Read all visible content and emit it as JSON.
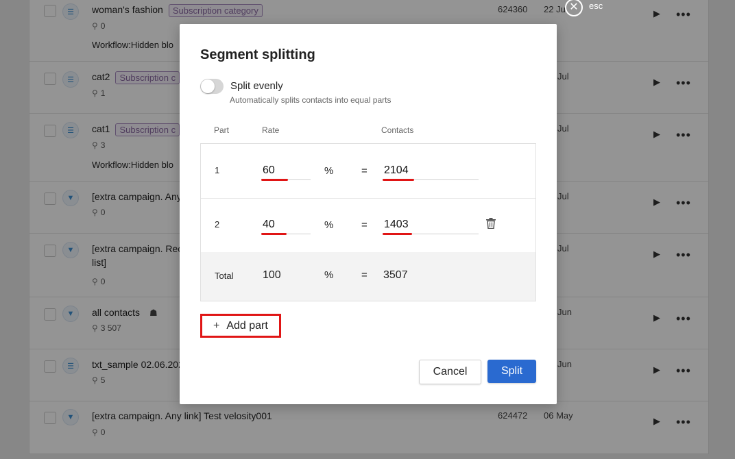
{
  "background_list": {
    "rows": [
      {
        "name": "woman's fashion",
        "tag": "Subscription category",
        "count": "0",
        "workflow": "Workflow:Hidden blo",
        "id": "624360",
        "date": "22 Ju"
      },
      {
        "name": "cat2",
        "tag": "Subscription c",
        "count": "1",
        "workflow": "",
        "id": "",
        "date": "Jul"
      },
      {
        "name": "cat1",
        "tag": "Subscription c",
        "count": "3",
        "workflow": "Workflow:Hidden blo",
        "id": "",
        "date": "Jul"
      },
      {
        "name": "[extra campaign. Any",
        "tag": "",
        "count": "0",
        "workflow": "",
        "id": "",
        "date": "Jul"
      },
      {
        "name": "[extra campaign. Rec",
        "name2": "list]",
        "tag": "",
        "count": "0",
        "workflow": "",
        "id": "",
        "date": "Jul"
      },
      {
        "name": "all contacts",
        "tag": "",
        "count": "3 507",
        "workflow": "",
        "id": "",
        "date": "Jun"
      },
      {
        "name": "txt_sample 02.06.202",
        "tag": "",
        "count": "5",
        "workflow": "",
        "id": "",
        "date": "Jun"
      },
      {
        "name": "[extra campaign. Any link] Test velosity001",
        "tag": "",
        "count": "0",
        "workflow": "",
        "id": "624472",
        "date": "06 May"
      }
    ],
    "more_label": "•••"
  },
  "esc": {
    "label": "esc"
  },
  "modal": {
    "title": "Segment splitting",
    "toggle": {
      "label": "Split evenly",
      "description": "Automatically splits contacts into equal parts",
      "on": false
    },
    "headers": {
      "part": "Part",
      "rate": "Rate",
      "contacts": "Contacts"
    },
    "parts": [
      {
        "part": "1",
        "rate": "60",
        "unit": "%",
        "eq": "=",
        "contacts": "2104"
      },
      {
        "part": "2",
        "rate": "40",
        "unit": "%",
        "eq": "=",
        "contacts": "1403"
      }
    ],
    "total": {
      "label": "Total",
      "rate": "100",
      "unit": "%",
      "eq": "=",
      "contacts": "3507"
    },
    "add_part_label": "Add part",
    "cancel_label": "Cancel",
    "split_label": "Split",
    "accent_color": "#2a6ad0",
    "highlight_color": "#e01515"
  }
}
